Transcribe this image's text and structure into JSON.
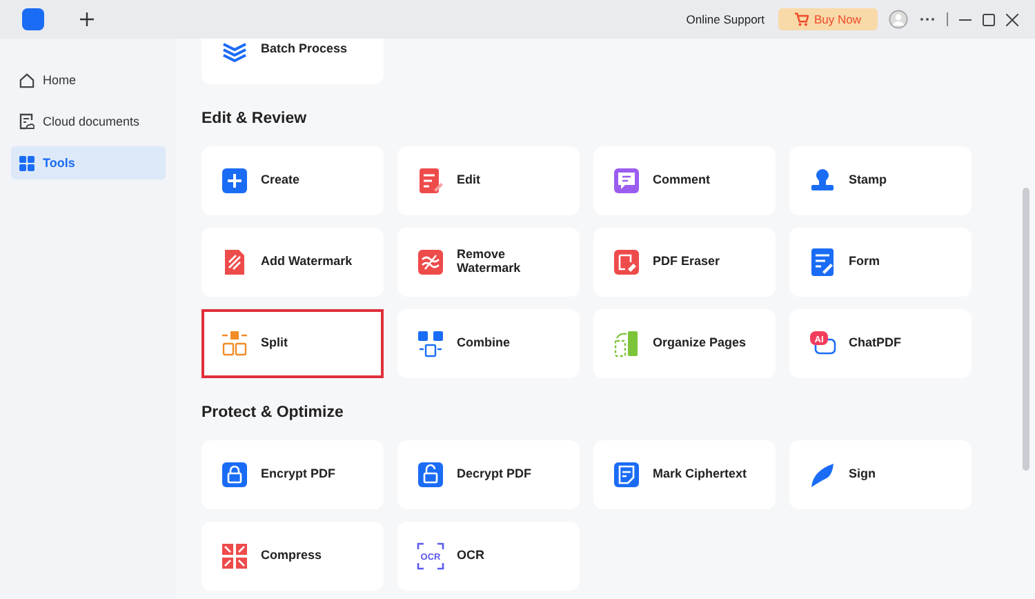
{
  "titlebar": {
    "online_support": "Online Support",
    "buy_now": "Buy Now"
  },
  "sidebar": {
    "items": [
      {
        "label": "Home",
        "selected": false
      },
      {
        "label": "Cloud documents",
        "selected": false
      },
      {
        "label": "Tools",
        "selected": true
      }
    ]
  },
  "sections": [
    {
      "tools": [
        {
          "label": "Batch Process",
          "highlighted": false
        }
      ]
    },
    {
      "title": "Edit & Review",
      "tools": [
        {
          "label": "Create",
          "highlighted": false
        },
        {
          "label": "Edit",
          "highlighted": false
        },
        {
          "label": "Comment",
          "highlighted": false
        },
        {
          "label": "Stamp",
          "highlighted": false
        },
        {
          "label": "Add Watermark",
          "highlighted": false
        },
        {
          "label": "Remove Watermark",
          "highlighted": false
        },
        {
          "label": "PDF Eraser",
          "highlighted": false
        },
        {
          "label": "Form",
          "highlighted": false
        },
        {
          "label": "Split",
          "highlighted": true
        },
        {
          "label": "Combine",
          "highlighted": false
        },
        {
          "label": "Organize Pages",
          "highlighted": false
        },
        {
          "label": "ChatPDF",
          "highlighted": false,
          "icon_label": "AI"
        }
      ]
    },
    {
      "title": "Protect & Optimize",
      "tools": [
        {
          "label": "Encrypt PDF",
          "highlighted": false
        },
        {
          "label": "Decrypt PDF",
          "highlighted": false
        },
        {
          "label": "Mark Ciphertext",
          "highlighted": false
        },
        {
          "label": "Sign",
          "highlighted": false
        },
        {
          "label": "Compress",
          "highlighted": false
        },
        {
          "label": "OCR",
          "highlighted": false,
          "icon_label": "OCR"
        }
      ]
    }
  ]
}
